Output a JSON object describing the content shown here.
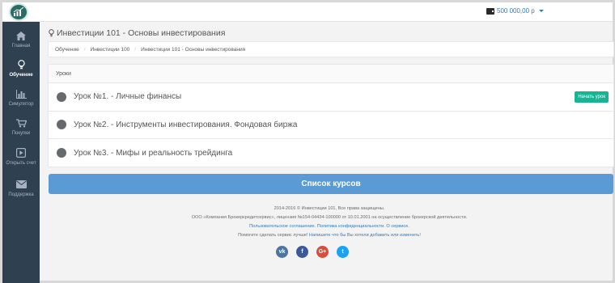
{
  "topbar": {
    "balance": "500 000,00 р"
  },
  "sidebar": {
    "items": [
      {
        "label": "Главная",
        "icon": "home-icon"
      },
      {
        "label": "Обучение",
        "icon": "lightbulb-icon"
      },
      {
        "label": "Симулятор",
        "icon": "bar-chart-icon"
      },
      {
        "label": "Покупки",
        "icon": "cart-icon"
      },
      {
        "label": "Открыть счет",
        "icon": "play-square-icon"
      },
      {
        "label": "Поддержка",
        "icon": "envelope-icon"
      }
    ]
  },
  "page": {
    "title": "Инвестиции 101 - Основы инвестирования"
  },
  "breadcrumb": [
    "Обучение",
    "Инвестиции 100",
    "Инвестиции 101 - Основы инвестирования"
  ],
  "lessons": {
    "header": "Уроки",
    "items": [
      {
        "title": "Урок №1. - Личные финансы",
        "action": "Начать урок"
      },
      {
        "title": "Урок №2. - Инструменты инвестирования. Фондовая биржа",
        "action": ""
      },
      {
        "title": "Урок №3. - Мифы и реальность трейдинга",
        "action": ""
      }
    ]
  },
  "courses_button": "Список курсов",
  "footer": {
    "copyright": "2014-2016 © Инвестиции 101, Все права защищены.",
    "license": "ООО «Компания Брокеркредитсервис», лицензия №154-04434-100000 от 10.01.2001 на осуществление брокерской деятельности.",
    "user_agreement": "Пользовательское соглашение.",
    "privacy": "Политика конфиденциальности.",
    "about": "О сервисе.",
    "help_text": "Помогите сделать сервис лучше!",
    "help_link": "Напишите что бы Вы хотели добавить или изменить!"
  },
  "socials": [
    {
      "name": "vk",
      "glyph": "vk",
      "color": "#4c75a3"
    },
    {
      "name": "facebook",
      "glyph": "f",
      "color": "#3b5998"
    },
    {
      "name": "google-plus",
      "glyph": "G+",
      "color": "#dd4b39"
    },
    {
      "name": "twitter",
      "glyph": "t",
      "color": "#1da1f2"
    }
  ],
  "colors": {
    "sidebar": "#2f4050",
    "accent": "#1ab394",
    "primary_button": "#5a9bd5",
    "link": "#337ab7"
  }
}
